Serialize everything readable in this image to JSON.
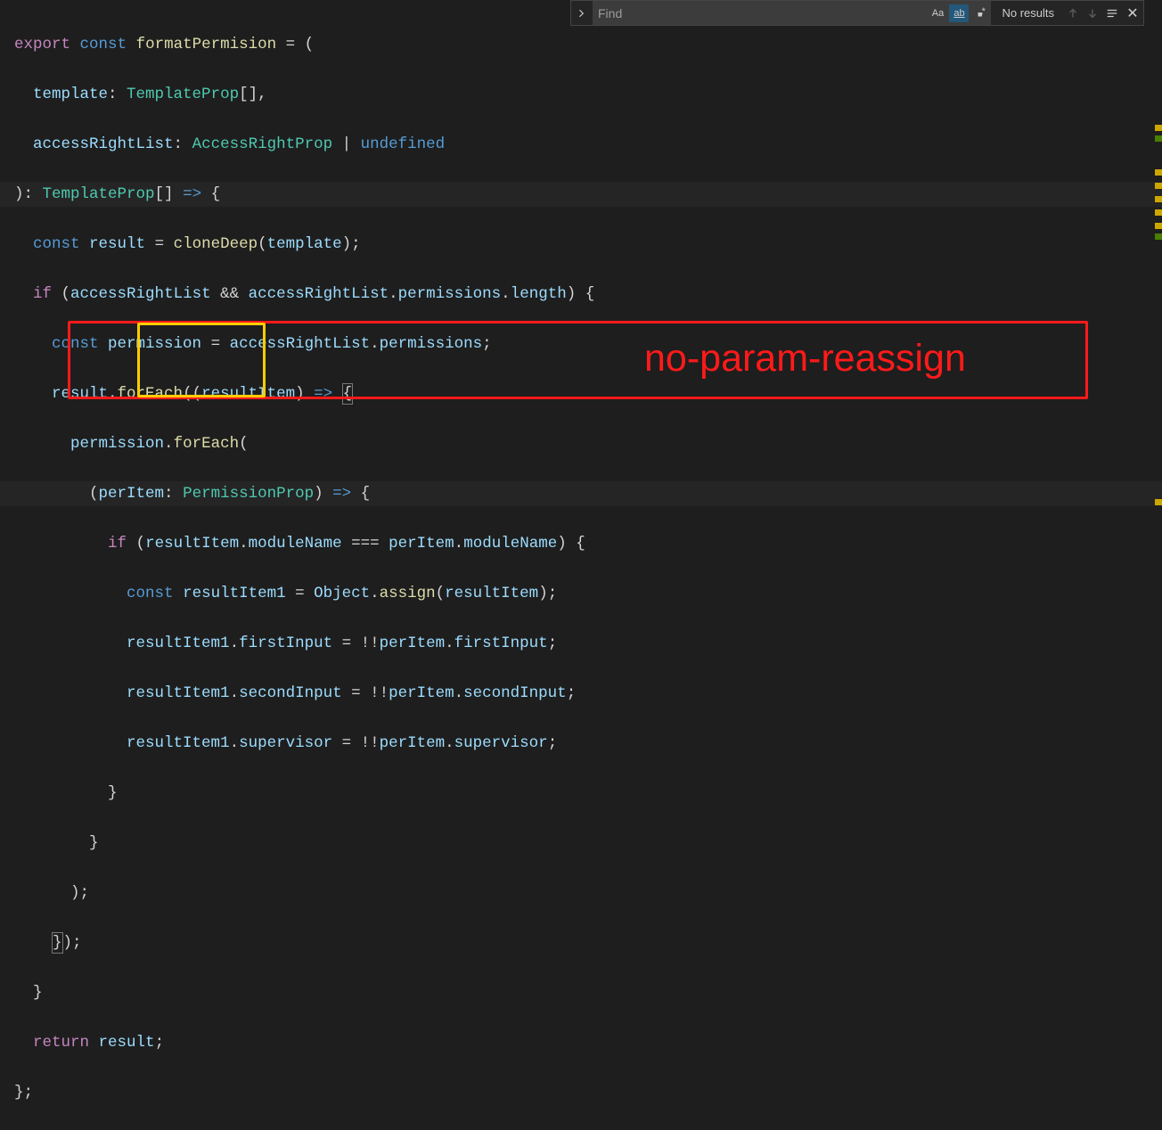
{
  "find": {
    "placeholder": "Find",
    "value": "",
    "opt_case": "Aa",
    "opt_word": "ab",
    "opt_regex": ".*",
    "results": "No results"
  },
  "annotation": {
    "label": "no-param-reassign"
  },
  "code": {
    "l1": {
      "a": "export",
      "b": "const",
      "c": "formatPermision",
      "d": " = ("
    },
    "l2": {
      "a": "template",
      "b": ": ",
      "c": "TemplateProp",
      "d": "[],"
    },
    "l3": {
      "a": "accessRightList",
      "b": ": ",
      "c": "AccessRightProp",
      "d": " | ",
      "e": "undefined"
    },
    "l4": {
      "a": "): ",
      "b": "TemplateProp",
      "c": "[] ",
      "d": "=>",
      "e": " {"
    },
    "l5": {
      "a": "const",
      "b": "result",
      "c": " = ",
      "d": "cloneDeep",
      "e": "(",
      "f": "template",
      "g": ");"
    },
    "l6": {
      "a": "if",
      "b": " (",
      "c": "accessRightList",
      "d": " && ",
      "e": "accessRightList",
      "f": ".",
      "g": "permissions",
      "h": ".",
      "i": "length",
      "j": ") {"
    },
    "l7": {
      "a": "const",
      "b": "permission",
      "c": " = ",
      "d": "accessRightList",
      "e": ".",
      "f": "permissions",
      "g": ";"
    },
    "l8": {
      "a": "result",
      "b": ".",
      "c": "forEach",
      "d": "((",
      "e": "resultItem",
      "f": ") ",
      "g": "=>",
      "h": " ",
      "i": "{"
    },
    "l9": {
      "a": "permission",
      "b": ".",
      "c": "forEach",
      "d": "("
    },
    "l10": {
      "a": "(",
      "b": "perItem",
      "c": ": ",
      "d": "PermissionProp",
      "e": ") ",
      "f": "=>",
      "g": " {"
    },
    "l11": {
      "a": "if",
      "b": " (",
      "c": "resultItem",
      "d": ".",
      "e": "moduleName",
      "f": " === ",
      "g": "perItem",
      "h": ".",
      "i": "moduleName",
      "j": ") {"
    },
    "l12": {
      "a": "const",
      "b": "resultItem1",
      "c": " = ",
      "d": "Object",
      "e": ".",
      "f": "assign",
      "g": "(",
      "h": "resultItem",
      "i": ");"
    },
    "l13": {
      "a": "resultItem1",
      "b": ".",
      "c": "firstInput",
      "d": " = !!",
      "e": "perItem",
      "f": ".",
      "g": "firstInput",
      "h": ";"
    },
    "l14": {
      "a": "resultItem1",
      "b": ".",
      "c": "secondInput",
      "d": " = !!",
      "e": "perItem",
      "f": ".",
      "g": "secondInput",
      "h": ";"
    },
    "l15": {
      "a": "resultItem1",
      "b": ".",
      "c": "supervisor",
      "d": " = !!",
      "e": "perItem",
      "f": ".",
      "g": "supervisor",
      "h": ";"
    },
    "l16": {
      "a": "}"
    },
    "l17": {
      "a": "}"
    },
    "l18": {
      "a": ");"
    },
    "l19": {
      "a": "}",
      "b": ");"
    },
    "l20": {
      "a": "}"
    },
    "l21": {
      "a": "return",
      "b": "result",
      "c": ";"
    },
    "l22": {
      "a": "};"
    }
  }
}
